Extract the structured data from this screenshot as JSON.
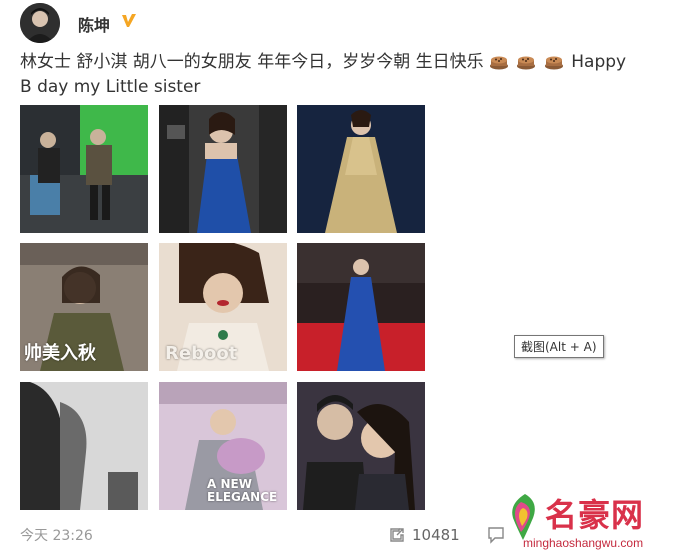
{
  "post": {
    "username": "陈坤",
    "text_line1": "林女士 舒小淇 胡八一的女朋友 年年今日，岁岁今朝 生日快乐",
    "text_tail": "Happy",
    "text_line2": "B day my Little sister",
    "timestamp": "今天 23:26",
    "repost_count": "10481"
  },
  "photos": [
    {
      "overlay": ""
    },
    {
      "overlay": ""
    },
    {
      "overlay": ""
    },
    {
      "overlay": "帅美入秋"
    },
    {
      "overlay": "Reboot"
    },
    {
      "overlay": ""
    },
    {
      "overlay": ""
    },
    {
      "overlay": "A NEW ELEGANCE"
    },
    {
      "overlay": ""
    }
  ],
  "tooltip": "截图(Alt + A)",
  "watermark": {
    "title": "名豪网",
    "url": "minghaoshangwu.com"
  },
  "icons": {
    "verified": "verified-v-icon",
    "cake": "cake-emoji-icon",
    "repost": "repost-icon",
    "comment": "comment-icon"
  },
  "colors": {
    "verified": "#f5a623",
    "watermark": "#d9314a",
    "muted": "#999999"
  }
}
